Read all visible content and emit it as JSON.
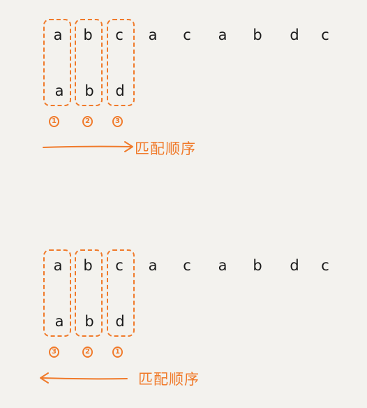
{
  "diagrams": [
    {
      "top_row": [
        "a",
        "b",
        "c",
        "a",
        "c",
        "a",
        "b",
        "d",
        "c"
      ],
      "bottom_row": [
        "a",
        "b",
        "d"
      ],
      "order_markers": [
        "1",
        "2",
        "3"
      ],
      "arrow_direction": "right",
      "arrow_label": "匹配顺序"
    },
    {
      "top_row": [
        "a",
        "b",
        "c",
        "a",
        "c",
        "a",
        "b",
        "d",
        "c"
      ],
      "bottom_row": [
        "a",
        "b",
        "d"
      ],
      "order_markers": [
        "3",
        "2",
        "1"
      ],
      "arrow_direction": "left",
      "arrow_label": "匹配顺序"
    }
  ],
  "colors": {
    "accent": "#f07a2a",
    "text": "#1a1a1a",
    "background": "#f3f2ee"
  }
}
